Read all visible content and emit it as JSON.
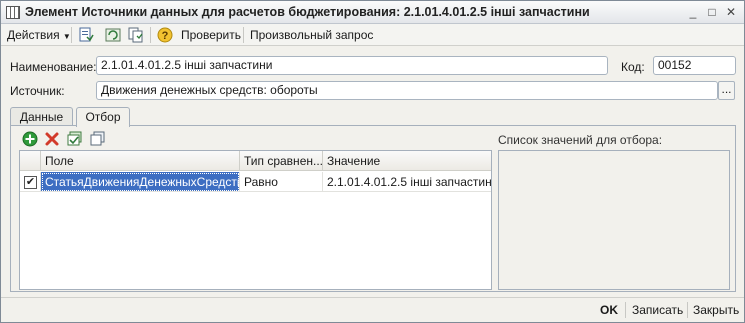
{
  "window": {
    "title": "Элемент Источники данных для расчетов бюджетирования: 2.1.01.4.01.2.5 інші запчастини",
    "controls": {
      "minimize": "_",
      "maximize": "□",
      "close": "✕"
    }
  },
  "toolbar": {
    "actions_label": "Действия",
    "check_label": "Проверить",
    "query_label": "Произвольный запрос"
  },
  "form": {
    "name_label": "Наименование:",
    "name_value": "2.1.01.4.01.2.5 інші запчастини",
    "code_label": "Код:",
    "code_value": "00152",
    "source_label": "Источник:",
    "source_value": "Движения денежных средств: обороты",
    "ellipsis": "..."
  },
  "tabs": [
    {
      "label": "Данные",
      "active": false
    },
    {
      "label": "Отбор",
      "active": true
    }
  ],
  "grid": {
    "columns": [
      "Поле",
      "Тип сравнен...",
      "Значение"
    ],
    "rows": [
      {
        "checked": true,
        "field": "СтатьяДвиженияДенежныхСредств",
        "comparison": "Равно",
        "value": "2.1.01.4.01.2.5 інші запчастини"
      }
    ]
  },
  "filter_list": {
    "label": "Список значений для отбора:"
  },
  "footer": {
    "ok_label": "OK",
    "save_label": "Записать",
    "close_label": "Закрыть"
  },
  "colors": {
    "selection": "#3d6ec2",
    "add_icon": "#2f9a3a",
    "delete_icon": "#d23a2a"
  }
}
